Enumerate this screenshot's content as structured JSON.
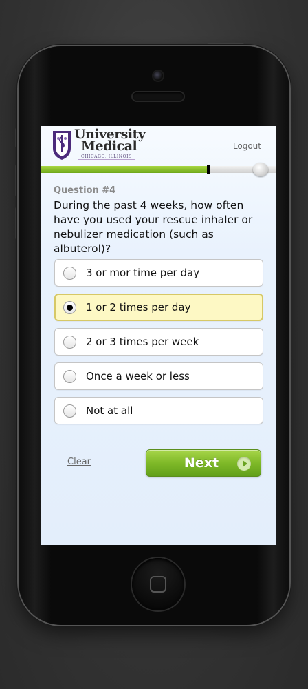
{
  "header": {
    "logo_line1": "University",
    "logo_line2": "Medical",
    "logo_tagline": "CHICAGO, ILLINOIS",
    "logout_label": "Logout"
  },
  "progress": {
    "value_fraction": 0.71
  },
  "question": {
    "number_label": "Question #4",
    "text": "During the past 4 weeks, how often have you used your rescue inhaler or nebulizer medication (such as albuterol)?"
  },
  "options": [
    {
      "label": "3 or mor time per day",
      "selected": false
    },
    {
      "label": "1 or 2 times per day",
      "selected": true
    },
    {
      "label": "2 or 3 times per week",
      "selected": false
    },
    {
      "label": "Once a week or less",
      "selected": false
    },
    {
      "label": "Not at all",
      "selected": false
    }
  ],
  "actions": {
    "clear_label": "Clear",
    "next_label": "Next"
  },
  "colors": {
    "accent_green": "#7fb928",
    "selected_bg": "#fdf8c4",
    "brand_purple": "#4b2a7b"
  }
}
